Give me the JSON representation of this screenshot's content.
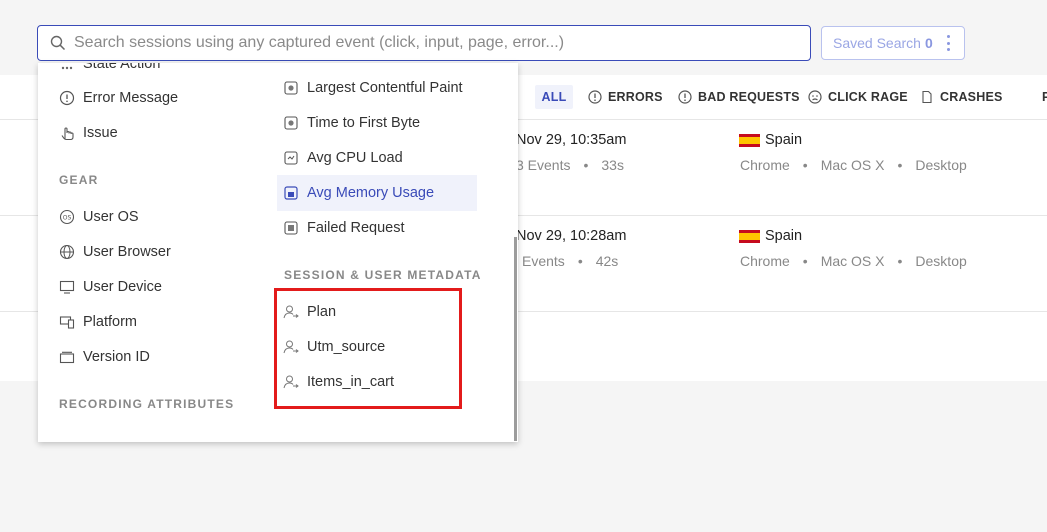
{
  "search": {
    "placeholder": "Search sessions using any captured event (click, input, page, error...)"
  },
  "saved_search": {
    "label": "Saved Search",
    "count": "0"
  },
  "tabs": [
    {
      "label": "ALL"
    },
    {
      "label": "ERRORS"
    },
    {
      "label": "BAD REQUESTS"
    },
    {
      "label": "CLICK RAGE"
    },
    {
      "label": "CRASHES"
    },
    {
      "label": "P"
    }
  ],
  "sessions": [
    {
      "date": "Nov 29, 10:35am",
      "events": "3 Events",
      "duration": "33s",
      "country": "Spain",
      "browser": "Chrome",
      "os": "Mac OS X",
      "device": "Desktop"
    },
    {
      "date": "Nov 29, 10:28am",
      "events": "Events",
      "duration": "42s",
      "country": "Spain",
      "browser": "Chrome",
      "os": "Mac OS X",
      "device": "Desktop"
    }
  ],
  "filters": {
    "left": {
      "partial_item": "State Action",
      "items_top": [
        {
          "label": "Error Message",
          "icon": "error-circle-icon"
        },
        {
          "label": "Issue",
          "icon": "pointer-hand-icon"
        }
      ],
      "gear_title": "GEAR",
      "gear_items": [
        {
          "label": "User OS",
          "icon": "os-icon"
        },
        {
          "label": "User Browser",
          "icon": "globe-icon"
        },
        {
          "label": "User Device",
          "icon": "monitor-icon"
        },
        {
          "label": "Platform",
          "icon": "devices-icon"
        },
        {
          "label": "Version ID",
          "icon": "folder-icon"
        }
      ],
      "recording_title": "RECORDING ATTRIBUTES"
    },
    "right": {
      "items": [
        {
          "label": "Largest Contentful Paint",
          "icon": "metric-icon"
        },
        {
          "label": "Time to First Byte",
          "icon": "metric-icon"
        },
        {
          "label": "Avg CPU Load",
          "icon": "cpu-icon"
        },
        {
          "label": "Avg Memory Usage",
          "icon": "memory-icon",
          "active": true
        },
        {
          "label": "Failed Request",
          "icon": "request-icon"
        }
      ],
      "metadata_title": "SESSION & USER METADATA",
      "metadata_items": [
        {
          "label": "Plan",
          "icon": "user-meta-icon"
        },
        {
          "label": "Utm_source",
          "icon": "user-meta-icon"
        },
        {
          "label": "Items_in_cart",
          "icon": "user-meta-icon"
        }
      ]
    }
  },
  "colors": {
    "accent": "#3a4bb8",
    "highlight": "#e31b1b"
  }
}
